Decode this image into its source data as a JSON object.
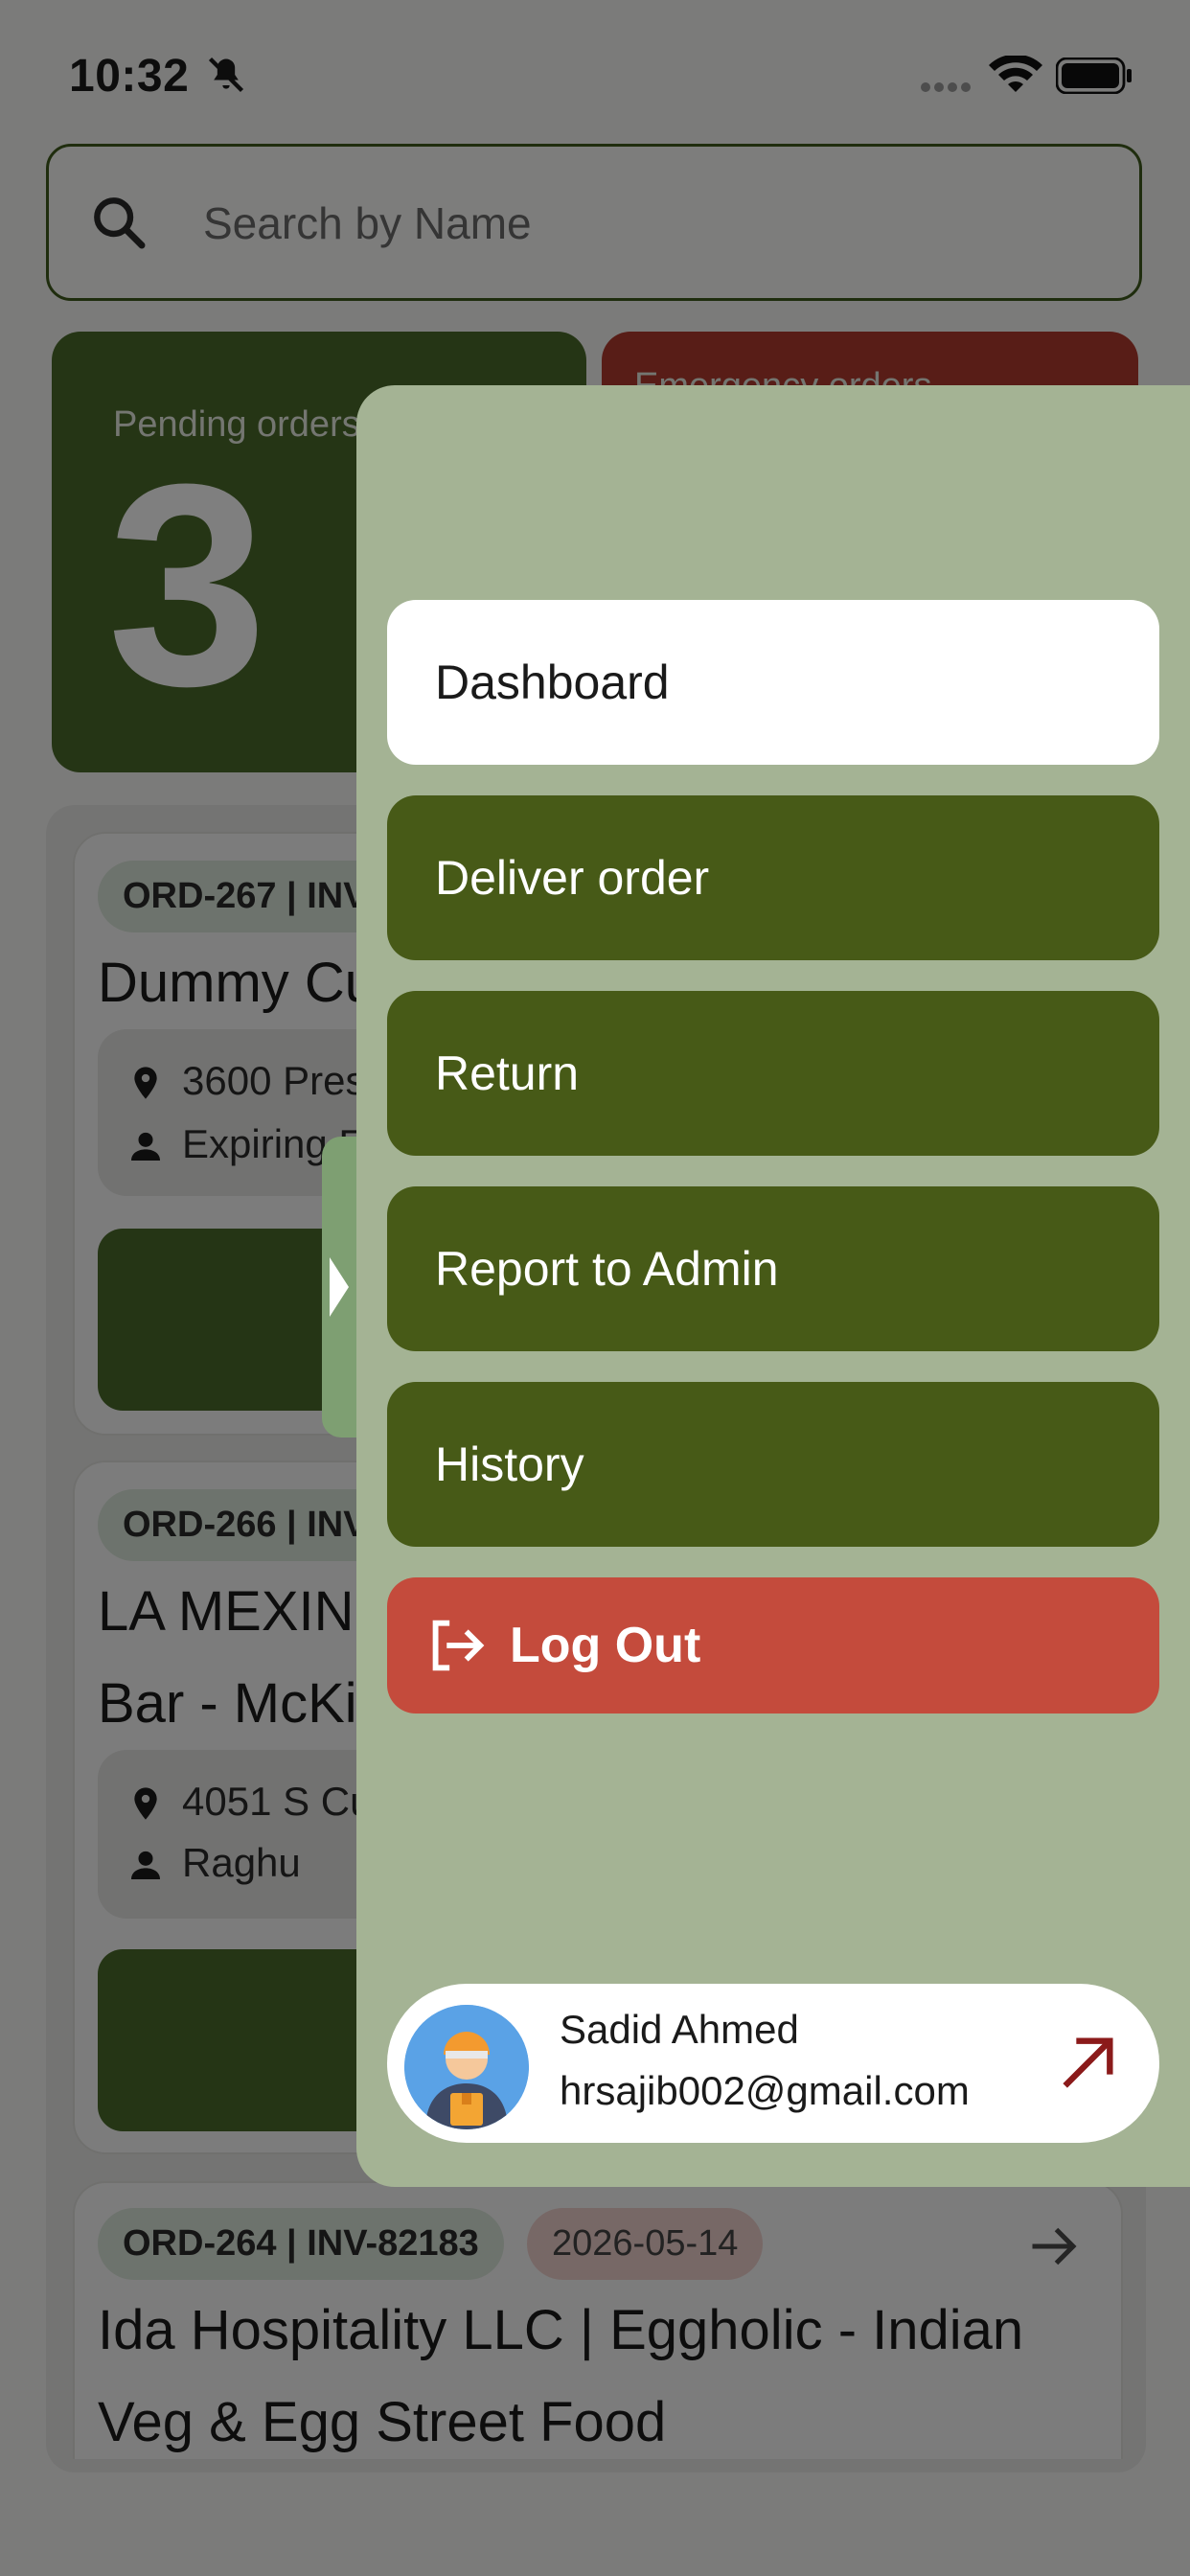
{
  "status_bar": {
    "time": "10:32"
  },
  "search": {
    "placeholder": "Search by Name"
  },
  "stats": {
    "pending_label": "Pending orders",
    "pending_count": "3",
    "emergency_label": "Emergency orders"
  },
  "orders": [
    {
      "tag": "ORD-267 | INV",
      "title": "Dummy Cu",
      "address": "3600 Pres",
      "contact": "Expiring El"
    },
    {
      "tag": "ORD-266 | INV",
      "title_line1": "LA MEXIND",
      "title_line2": "Bar - McKin",
      "address": "4051 S Cus",
      "contact": "Raghu"
    },
    {
      "tag": "ORD-264 | INV-82183",
      "date": "2026-05-14",
      "title_line1": "Ida Hospitality LLC | Eggholic - Indian",
      "title_line2": "Veg & Egg Street Food"
    }
  ],
  "menu": {
    "dashboard": "Dashboard",
    "deliver_order": "Deliver order",
    "return": "Return",
    "report_admin": "Report to Admin",
    "history": "History",
    "logout": "Log Out"
  },
  "profile": {
    "name": "Sadid Ahmed",
    "email": "hrsajib002@gmail.com"
  },
  "colors": {
    "primary_green": "#475a17",
    "drawer_bg": "#a4b394",
    "logout_red": "#c44b3c",
    "emergency_red": "#b03a2e",
    "link_arrow": "#8b1a1a"
  },
  "icons": [
    "bell-slash-icon",
    "signal-icon",
    "wifi-icon",
    "battery-icon",
    "search-icon",
    "pin-icon",
    "person-icon",
    "arrow-right-icon",
    "chevron-right-icon",
    "logout-icon",
    "avatar",
    "external-link-icon"
  ]
}
